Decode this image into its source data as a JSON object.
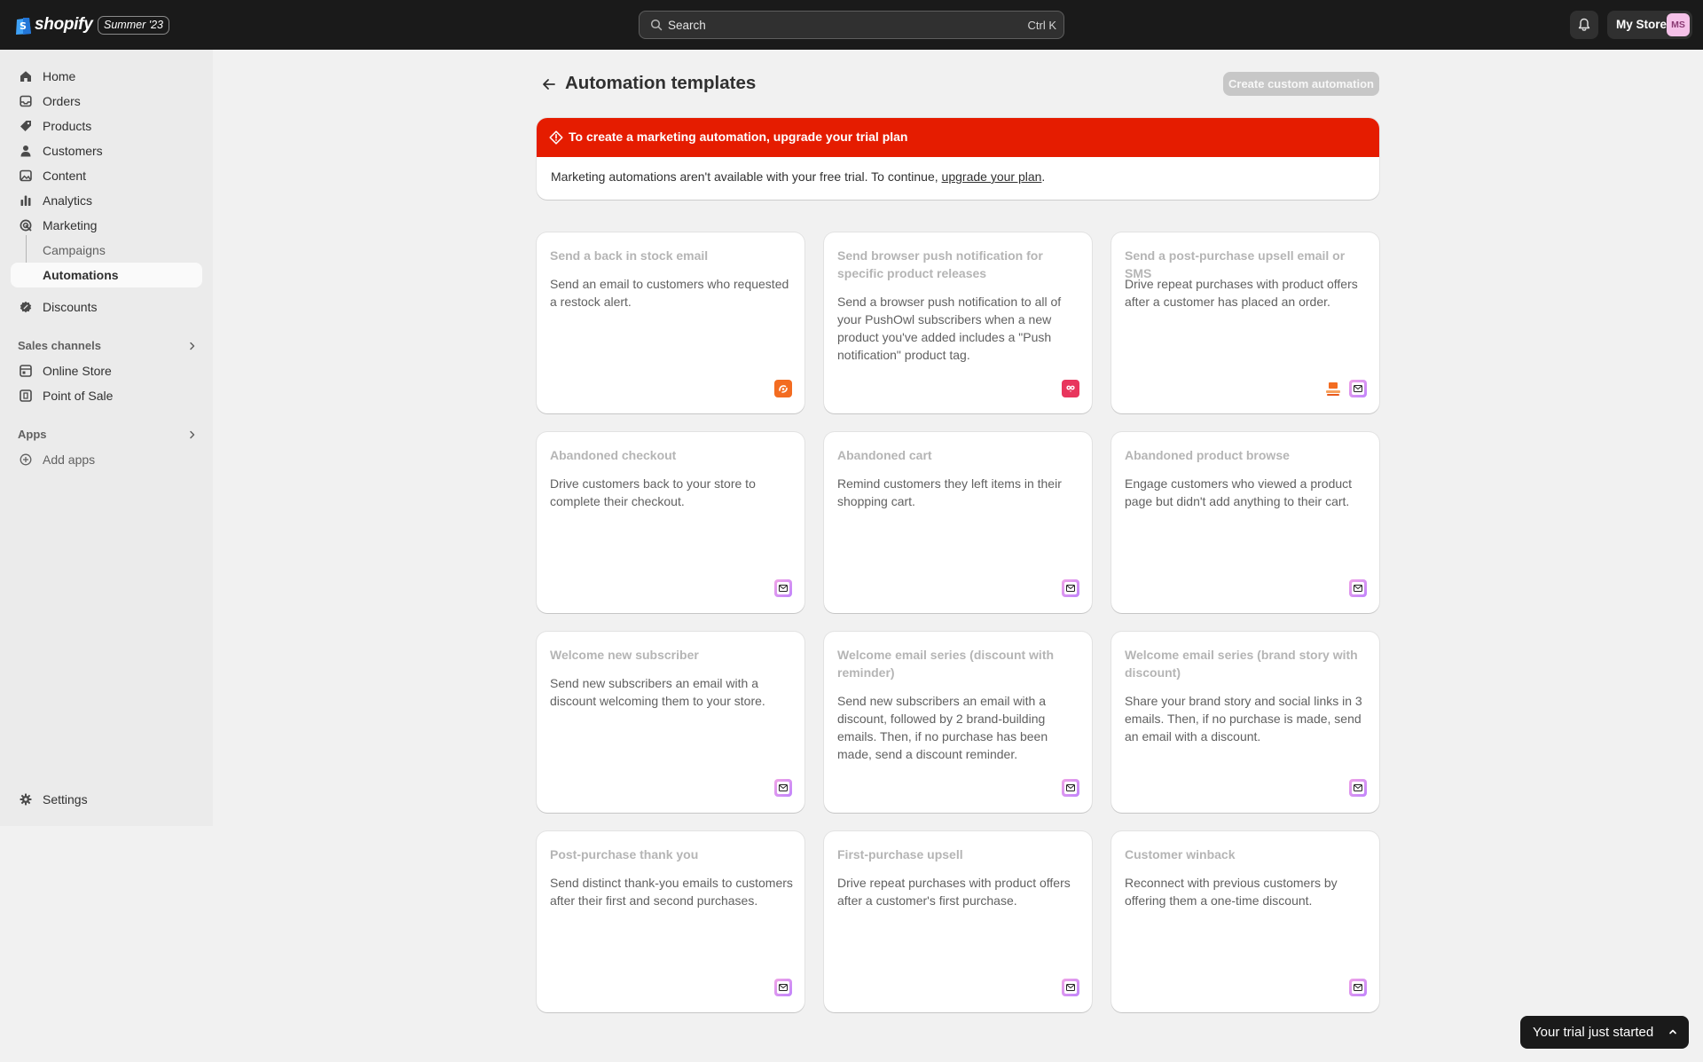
{
  "topbar": {
    "logo_text": "shopify",
    "edition": "Summer '23",
    "search_placeholder": "Search",
    "search_shortcut": "Ctrl K",
    "store_name": "My Store",
    "avatar_initials": "MS"
  },
  "sidebar": {
    "items": [
      {
        "label": "Home",
        "icon": "home-icon"
      },
      {
        "label": "Orders",
        "icon": "inbox-icon"
      },
      {
        "label": "Products",
        "icon": "tag-icon"
      },
      {
        "label": "Customers",
        "icon": "person-icon"
      },
      {
        "label": "Content",
        "icon": "image-icon"
      },
      {
        "label": "Analytics",
        "icon": "bar-chart-icon"
      },
      {
        "label": "Marketing",
        "icon": "target-icon"
      }
    ],
    "sub_items": [
      {
        "label": "Campaigns"
      },
      {
        "label": "Automations"
      }
    ],
    "discounts": {
      "label": "Discounts",
      "icon": "discount-icon"
    },
    "sales_channels_label": "Sales channels",
    "channels": [
      {
        "label": "Online Store",
        "icon": "store-icon"
      },
      {
        "label": "Point of Sale",
        "icon": "pos-icon"
      }
    ],
    "apps_label": "Apps",
    "add_apps": {
      "label": "Add apps",
      "icon": "plus-circle-icon"
    },
    "settings": {
      "label": "Settings",
      "icon": "gear-icon"
    }
  },
  "page": {
    "title": "Automation templates",
    "primary_action": "Create custom automation"
  },
  "banner": {
    "title": "To create a marketing automation, upgrade your trial plan",
    "body_prefix": "Marketing automations aren't available with your free trial. To continue, ",
    "link_text": "upgrade your plan",
    "body_suffix": ".",
    "status_color": "#e51c00"
  },
  "cards": [
    {
      "title": "Send a back in stock email",
      "description": "Send an email to customers who requested a restock alert.",
      "icons": [
        "restock-app-icon"
      ]
    },
    {
      "title": "Send browser push notification for specific product releases",
      "description": "Send a browser push notification to all of your PushOwl subscribers when a new product you've added includes a \"Push notification\" product tag.",
      "icons": [
        "pushowl-app-icon"
      ]
    },
    {
      "title": "Send a post-purchase upsell email or SMS",
      "description": "Drive repeat purchases with product offers after a customer has placed an order.",
      "icons": [
        "upsell-app-icon",
        "shopify-email-icon"
      ]
    },
    {
      "title": "Abandoned checkout",
      "description": "Drive customers back to your store to complete their checkout.",
      "icons": [
        "shopify-email-icon"
      ]
    },
    {
      "title": "Abandoned cart",
      "description": "Remind customers they left items in their shopping cart.",
      "icons": [
        "shopify-email-icon"
      ]
    },
    {
      "title": "Abandoned product browse",
      "description": "Engage customers who viewed a product page but didn't add anything to their cart.",
      "icons": [
        "shopify-email-icon"
      ]
    },
    {
      "title": "Welcome new subscriber",
      "description": "Send new subscribers an email with a discount welcoming them to your store.",
      "icons": [
        "shopify-email-icon"
      ]
    },
    {
      "title": "Welcome email series (discount with reminder)",
      "description": "Send new subscribers an email with a discount, followed by 2 brand-building emails. Then, if no purchase has been made, send a discount reminder.",
      "icons": [
        "shopify-email-icon"
      ]
    },
    {
      "title": "Welcome email series (brand story with discount)",
      "description": "Share your brand story and social links in 3 emails. Then, if no purchase is made, send an email with a discount.",
      "icons": [
        "shopify-email-icon"
      ]
    },
    {
      "title": "Post-purchase thank you",
      "description": "Send distinct thank-you emails to customers after their first and second purchases.",
      "icons": [
        "shopify-email-icon"
      ]
    },
    {
      "title": "First-purchase upsell",
      "description": "Drive repeat purchases with product offers after a customer's first purchase.",
      "icons": [
        "shopify-email-icon"
      ]
    },
    {
      "title": "Customer winback",
      "description": "Reconnect with previous customers by offering them a one-time discount.",
      "icons": [
        "shopify-email-icon"
      ]
    }
  ],
  "trial": {
    "label": "Your trial just started"
  }
}
